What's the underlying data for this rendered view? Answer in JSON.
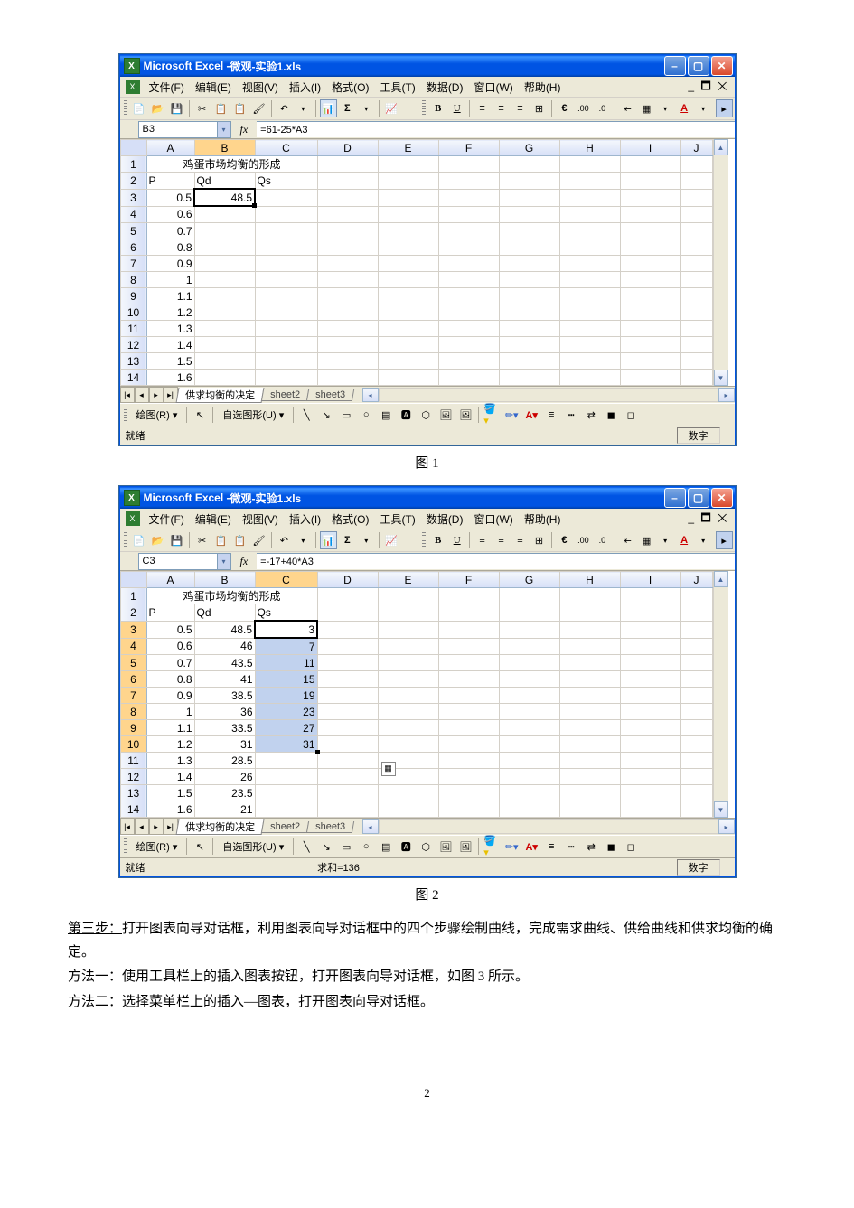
{
  "window": {
    "app_title_prefix": "Microsoft Excel - ",
    "doc_title": "微观-实验1.xls"
  },
  "menus": {
    "file": "文件(F)",
    "edit": "编辑(E)",
    "view": "视图(V)",
    "insert": "插入(I)",
    "format": "格式(O)",
    "tools": "工具(T)",
    "data": "数据(D)",
    "window": "窗口(W)",
    "help": "帮助(H)"
  },
  "doc_controls": "_ ✕",
  "columns": [
    "A",
    "B",
    "C",
    "D",
    "E",
    "F",
    "G",
    "H",
    "I",
    "J"
  ],
  "screenshot1": {
    "name_box": "B3",
    "formula": "=61-25*A3",
    "header_title": "鸡蛋市场均衡的形成",
    "row2": {
      "A": "P",
      "B": "Qd",
      "C": "Qs"
    },
    "rows": [
      {
        "n": 3,
        "A": "0.5",
        "B": "48.5"
      },
      {
        "n": 4,
        "A": "0.6"
      },
      {
        "n": 5,
        "A": "0.7"
      },
      {
        "n": 6,
        "A": "0.8"
      },
      {
        "n": 7,
        "A": "0.9"
      },
      {
        "n": 8,
        "A": "1"
      },
      {
        "n": 9,
        "A": "1.1"
      },
      {
        "n": 10,
        "A": "1.2"
      },
      {
        "n": 11,
        "A": "1.3"
      },
      {
        "n": 12,
        "A": "1.4"
      },
      {
        "n": 13,
        "A": "1.5"
      },
      {
        "n": 14,
        "A": "1.6"
      }
    ],
    "status": "就绪",
    "status_right": "数字",
    "caption": "图 1"
  },
  "screenshot2": {
    "name_box": "C3",
    "formula": "=-17+40*A3",
    "header_title": "鸡蛋市场均衡的形成",
    "row2": {
      "A": "P",
      "B": "Qd",
      "C": "Qs"
    },
    "rows": [
      {
        "n": 3,
        "A": "0.5",
        "B": "48.5",
        "C": "3"
      },
      {
        "n": 4,
        "A": "0.6",
        "B": "46",
        "C": "7"
      },
      {
        "n": 5,
        "A": "0.7",
        "B": "43.5",
        "C": "11"
      },
      {
        "n": 6,
        "A": "0.8",
        "B": "41",
        "C": "15"
      },
      {
        "n": 7,
        "A": "0.9",
        "B": "38.5",
        "C": "19"
      },
      {
        "n": 8,
        "A": "1",
        "B": "36",
        "C": "23"
      },
      {
        "n": 9,
        "A": "1.1",
        "B": "33.5",
        "C": "27"
      },
      {
        "n": 10,
        "A": "1.2",
        "B": "31",
        "C": "31"
      },
      {
        "n": 11,
        "A": "1.3",
        "B": "28.5"
      },
      {
        "n": 12,
        "A": "1.4",
        "B": "26"
      },
      {
        "n": 13,
        "A": "1.5",
        "B": "23.5"
      },
      {
        "n": 14,
        "A": "1.6",
        "B": "21"
      }
    ],
    "status": "就绪",
    "status_sum": "求和=136",
    "status_right": "数字",
    "caption": "图 2"
  },
  "sheet_tabs": {
    "active": "供求均衡的决定",
    "s2": "sheet2",
    "s3": "sheet3"
  },
  "draw_label": "绘图(R)",
  "autoshape": "自选图形(U)",
  "body": {
    "p1a": "第三步：",
    "p1b": "打开图表向导对话框，利用图表向导对话框中的四个步骤绘制曲线，完成需求曲线、供给曲线和供求均衡的确定。",
    "p2": "方法一：使用工具栏上的插入图表按钮，打开图表向导对话框，如图 3 所示。",
    "p3": "方法二：选择菜单栏上的插入—图表，打开图表向导对话框。"
  },
  "page_number": "2"
}
